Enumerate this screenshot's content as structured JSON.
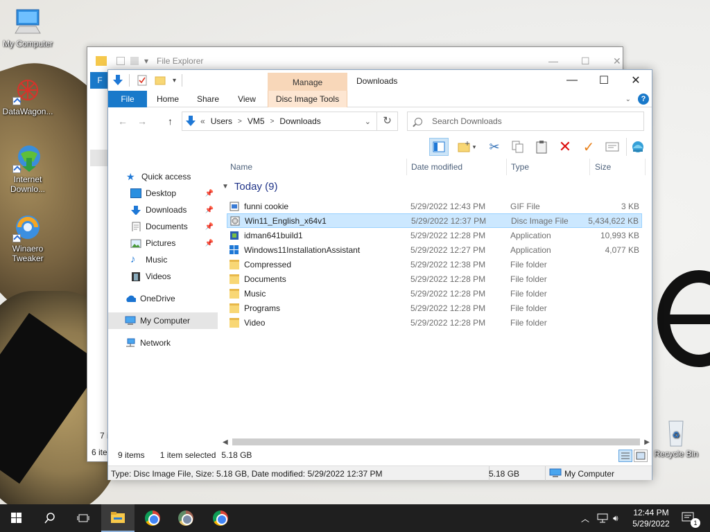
{
  "desktop": {
    "icons": [
      {
        "label": "My Computer",
        "icon": "computer-icon"
      },
      {
        "label": "DataWagon...",
        "icon": "datawagon-icon"
      },
      {
        "label": "Internet Downlo...",
        "icon": "idm-icon"
      },
      {
        "label": "Winaero Tweaker",
        "icon": "winaero-icon"
      },
      {
        "label": "Recycle Bin",
        "icon": "recycle-bin-icon"
      }
    ]
  },
  "back_window": {
    "title": "File Explorer",
    "ribbon_letter": "F",
    "status_count": "6 ite",
    "status_count2": "7 it"
  },
  "window": {
    "title": "Downloads",
    "contextual_group": "Manage",
    "ribbon_tabs": {
      "file": "File",
      "home": "Home",
      "share": "Share",
      "view": "View",
      "disc": "Disc Image Tools"
    },
    "help": "?",
    "address": {
      "crumbs": [
        "Users",
        "VM5",
        "Downloads"
      ],
      "prefix": "«"
    },
    "search_placeholder": "Search Downloads",
    "nav": {
      "quick_access": "Quick access",
      "desktop": "Desktop",
      "downloads": "Downloads",
      "documents": "Documents",
      "pictures": "Pictures",
      "music": "Music",
      "videos": "Videos",
      "onedrive": "OneDrive",
      "my_computer": "My Computer",
      "network": "Network"
    },
    "columns": {
      "name": "Name",
      "date": "Date modified",
      "type": "Type",
      "size": "Size"
    },
    "group_label": "Today (9)",
    "files": [
      {
        "name": "funni cookie",
        "date": "5/29/2022 12:43 PM",
        "type": "GIF File",
        "size": "3 KB"
      },
      {
        "name": "Win11_English_x64v1",
        "date": "5/29/2022 12:37 PM",
        "type": "Disc Image File",
        "size": "5,434,622 KB"
      },
      {
        "name": "idman641build1",
        "date": "5/29/2022 12:28 PM",
        "type": "Application",
        "size": "10,993 KB"
      },
      {
        "name": "Windows11InstallationAssistant",
        "date": "5/29/2022 12:27 PM",
        "type": "Application",
        "size": "4,077 KB"
      },
      {
        "name": "Compressed",
        "date": "5/29/2022 12:38 PM",
        "type": "File folder",
        "size": ""
      },
      {
        "name": "Documents",
        "date": "5/29/2022 12:28 PM",
        "type": "File folder",
        "size": ""
      },
      {
        "name": "Music",
        "date": "5/29/2022 12:28 PM",
        "type": "File folder",
        "size": ""
      },
      {
        "name": "Programs",
        "date": "5/29/2022 12:28 PM",
        "type": "File folder",
        "size": ""
      },
      {
        "name": "Video",
        "date": "5/29/2022 12:28 PM",
        "type": "File folder",
        "size": ""
      }
    ],
    "status": {
      "items": "9 items",
      "selected": "1 item selected",
      "selected_size": "5.18 GB"
    },
    "details": {
      "text": "Type: Disc Image File, Size: 5.18 GB, Date modified: 5/29/2022 12:37 PM",
      "size": "5.18 GB",
      "location": "My Computer"
    }
  },
  "taskbar": {
    "time": "12:44 PM",
    "date": "5/29/2022",
    "notification_count": "1"
  },
  "colors": {
    "accent": "#1979ca",
    "selection": "#cce8ff",
    "manage_tab": "#f8d7b9"
  }
}
